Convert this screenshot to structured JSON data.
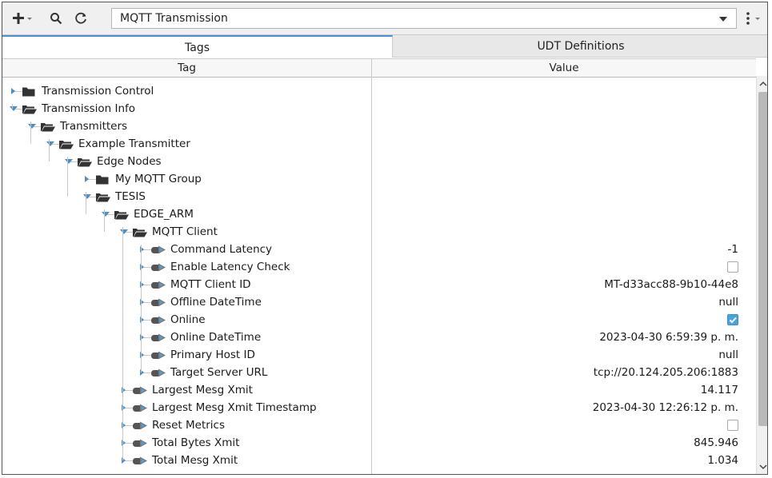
{
  "toolbar": {
    "add_icon": "plus-icon",
    "search_icon": "magnifier-icon",
    "refresh_icon": "refresh-icon",
    "provider_value": "MQTT Transmission",
    "more_icon": "vertical-ellipsis-icon"
  },
  "tabs": [
    {
      "label": "Tags",
      "active": true
    },
    {
      "label": "UDT Definitions",
      "active": false
    }
  ],
  "columns": {
    "tag": "Tag",
    "value": "Value"
  },
  "rows": [
    {
      "label": "Transmission Control",
      "depth": 0,
      "kind": "folder",
      "state": "collapsed",
      "value": ""
    },
    {
      "label": "Transmission Info",
      "depth": 0,
      "kind": "folder",
      "state": "expanded",
      "value": ""
    },
    {
      "label": "Transmitters",
      "depth": 1,
      "kind": "folder",
      "state": "expanded",
      "value": ""
    },
    {
      "label": "Example Transmitter",
      "depth": 2,
      "kind": "folder",
      "state": "expanded",
      "value": ""
    },
    {
      "label": "Edge Nodes",
      "depth": 3,
      "kind": "folder",
      "state": "expanded",
      "value": ""
    },
    {
      "label": "My MQTT Group",
      "depth": 4,
      "kind": "folder",
      "state": "collapsed",
      "value": ""
    },
    {
      "label": "TESIS",
      "depth": 4,
      "kind": "folder",
      "state": "expanded",
      "value": ""
    },
    {
      "label": "EDGE_ARM",
      "depth": 5,
      "kind": "folder",
      "state": "expanded",
      "value": ""
    },
    {
      "label": "MQTT Client",
      "depth": 6,
      "kind": "folder",
      "state": "expanded",
      "value": ""
    },
    {
      "label": "Command Latency",
      "depth": 7,
      "kind": "tag",
      "state": "collapsed",
      "value": "-1"
    },
    {
      "label": "Enable Latency Check",
      "depth": 7,
      "kind": "tag",
      "state": "collapsed",
      "value": "",
      "checkbox": false
    },
    {
      "label": "MQTT Client ID",
      "depth": 7,
      "kind": "tag",
      "state": "collapsed",
      "value": "MT-d33acc88-9b10-44e8"
    },
    {
      "label": "Offline DateTime",
      "depth": 7,
      "kind": "tag",
      "state": "collapsed",
      "value": "null"
    },
    {
      "label": "Online",
      "depth": 7,
      "kind": "tag",
      "state": "collapsed",
      "value": "",
      "checkbox": true
    },
    {
      "label": "Online DateTime",
      "depth": 7,
      "kind": "tag",
      "state": "collapsed",
      "value": "2023-04-30 6:59:39 p. m."
    },
    {
      "label": "Primary Host ID",
      "depth": 7,
      "kind": "tag",
      "state": "collapsed",
      "value": "null"
    },
    {
      "label": "Target Server URL",
      "depth": 7,
      "kind": "tag",
      "state": "collapsed",
      "value": "tcp://20.124.205.206:1883"
    },
    {
      "label": "Largest Mesg Xmit",
      "depth": 6,
      "kind": "tag",
      "state": "collapsed",
      "value": "14.117"
    },
    {
      "label": "Largest Mesg Xmit Timestamp",
      "depth": 6,
      "kind": "tag",
      "state": "collapsed",
      "value": "2023-04-30 12:26:12 p. m."
    },
    {
      "label": "Reset Metrics",
      "depth": 6,
      "kind": "tag",
      "state": "collapsed",
      "value": "",
      "checkbox": false
    },
    {
      "label": "Total Bytes Xmit",
      "depth": 6,
      "kind": "tag",
      "state": "collapsed",
      "value": "845.946"
    },
    {
      "label": "Total Mesg Xmit",
      "depth": 6,
      "kind": "tag",
      "state": "collapsed",
      "value": "1.034"
    }
  ]
}
